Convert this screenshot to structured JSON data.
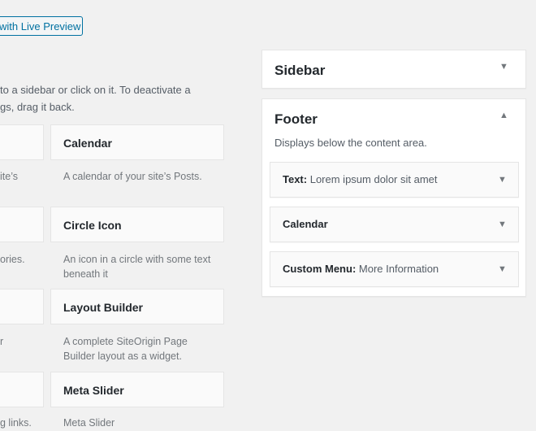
{
  "header": {
    "preview_button": "with Live Preview"
  },
  "intro": {
    "line1": "to a sidebar or click on it. To deactivate a",
    "line2": "gs, drag it back."
  },
  "widgets_left": [
    {
      "desc": "ite’s"
    },
    {
      "desc": "ories."
    },
    {
      "desc": "r"
    },
    {
      "desc": "g links."
    }
  ],
  "widgets_right": [
    {
      "title": "Calendar",
      "desc1": "A calendar of your site’s Posts.",
      "desc2": ""
    },
    {
      "title": "Circle Icon",
      "desc1": "An icon in a circle with some text",
      "desc2": "beneath it"
    },
    {
      "title": "Layout Builder",
      "desc1": "A complete SiteOrigin Page",
      "desc2": "Builder layout as a widget."
    },
    {
      "title": "Meta Slider",
      "desc1": "Meta Slider",
      "desc2": ""
    }
  ],
  "sidebar_area": {
    "title": "Sidebar"
  },
  "footer_area": {
    "title": "Footer",
    "description": "Displays below the content area.",
    "widgets": [
      {
        "type": "Text:",
        "name": " Lorem ipsum dolor sit amet"
      },
      {
        "type": "Calendar",
        "name": ""
      },
      {
        "type": "Custom Menu:",
        "name": " More Information"
      }
    ]
  },
  "colors": {
    "accent": "#0071a1",
    "background": "#f1f1f1"
  },
  "icons": {
    "toggle_closed": "arrow-down-icon",
    "toggle_open": "arrow-up-icon"
  }
}
